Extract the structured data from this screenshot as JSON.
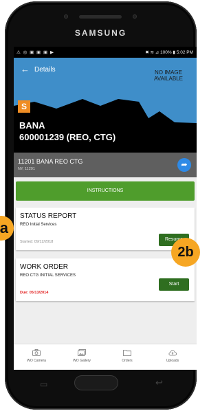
{
  "device": {
    "brand": "SAMSUNG"
  },
  "statusbar": {
    "left_icons": "⚠ ◎ ▣ ▣ ▣ ▶",
    "right_text": "✖ ≋ ⊿ 100% ▮ 5:02 PM"
  },
  "header": {
    "back_icon": "arrow-left-icon",
    "title": "Details",
    "no_image_text": "NO IMAGE AVAILABLE",
    "badge": "S",
    "client": "BANA",
    "loan_line": "600001239 (REO, CTG)"
  },
  "address": {
    "line1": "11201 BANA REO CTG",
    "line2": "NY, 11201",
    "nav_icon": "navigation-arrow-icon"
  },
  "instructions_label": "INSTRUCTIONS",
  "orders": [
    {
      "title": "STATUS REPORT",
      "subtitle": "REO Initial Services",
      "date_text": "Started: 09/12/2018",
      "button_label": "Resume"
    },
    {
      "title": "WORK ORDER",
      "subtitle": "REO CTG INITIAL SERVICES",
      "date_text": "Due: 05/13/2014",
      "button_label": "Start"
    }
  ],
  "tabs": [
    {
      "label": "WO Camera",
      "icon": "camera-icon"
    },
    {
      "label": "WO Gallery",
      "icon": "gallery-icon"
    },
    {
      "label": "Orders",
      "icon": "folder-icon"
    },
    {
      "label": "Uploads",
      "icon": "cloud-upload-icon"
    }
  ],
  "overlays": {
    "a": "a",
    "b": "2b"
  },
  "colors": {
    "accent_green": "#4f9d2c",
    "button_green": "#2f6e20",
    "sky_blue": "#3f8ec9",
    "badge_orange": "#ef8d24",
    "due_red": "#e11a1a",
    "annotation_orange": "#f6a623"
  }
}
